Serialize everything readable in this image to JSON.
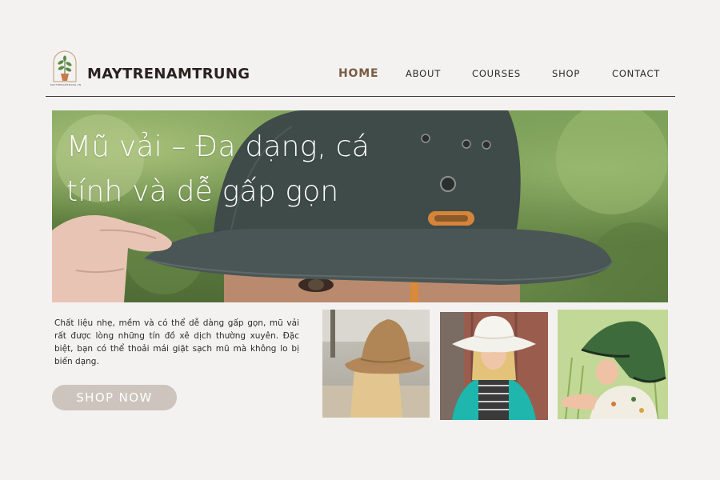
{
  "brand": {
    "name": "MAYTRENAMTRUNG",
    "tagline": "MAYTRENAMTRUNG.VN"
  },
  "nav": {
    "items": [
      {
        "label": "HOME",
        "active": true
      },
      {
        "label": "ABOUT",
        "active": false
      },
      {
        "label": "COURSES",
        "active": false
      },
      {
        "label": "SHOP",
        "active": false
      },
      {
        "label": "CONTACT",
        "active": false
      }
    ]
  },
  "hero": {
    "title": "Mũ vải – Đa dạng, cá tính và dễ gấp gọn"
  },
  "content": {
    "description": "Chất liệu nhẹ, mềm và có thể dễ dàng gấp gọn, mũ vải rất được lòng những tín đồ xê dịch thường xuyên. Đặc biệt, bạn có thể thoải mái giặt sạch mũ mà không lo bị biến dạng.",
    "cta_label": "SHOP NOW"
  },
  "colors": {
    "background": "#f4f2f0",
    "active_nav": "#7a5b43",
    "button_bg": "#ccc4bd",
    "hat_bucket": "#3c4a48",
    "hat_khaki": "#b08656",
    "hat_white": "#f3f1ec",
    "hat_green": "#3d6b3b"
  },
  "icons": {
    "logo": "potted-plant-arch-icon"
  }
}
